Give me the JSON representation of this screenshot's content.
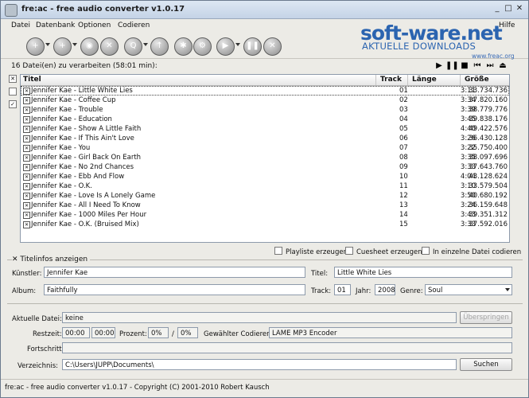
{
  "window": {
    "title": "fre:ac - free audio converter v1.0.17",
    "controls": {
      "minimize": "_",
      "maximize": "□",
      "close": "✕"
    }
  },
  "menu": [
    "Datei",
    "Datenbank",
    "Optionen",
    "Codieren"
  ],
  "help_menu": "Hilfe",
  "watermark": {
    "logo": "soft-ware.net",
    "subtitle": "AKTUELLE DOWNLOADS",
    "url": "www.freac.org"
  },
  "toolbar_icons": [
    "add-files-icon",
    "add-folder-icon",
    "cd-icon",
    "remove-icon",
    "search-cddb-icon",
    "submit-cddb-icon",
    "settings-icon",
    "config-icon",
    "start-encoding-icon",
    "pause-icon",
    "stop-icon"
  ],
  "file_count_label": "16 Datei(en) zu verarbeiten (58:01 min):",
  "player_controls": {
    "play": "▶",
    "pause": "❚❚",
    "stop": "■",
    "prev": "⏮",
    "next": "⏭",
    "eject": "⏏"
  },
  "list": {
    "columns": {
      "title": "Titel",
      "track": "Track",
      "length": "Länge",
      "size": "Größe"
    },
    "rows": [
      {
        "title": "Jennifer Kae - Little White Lies",
        "track": "01",
        "length": "3:11",
        "size": "33.734.736"
      },
      {
        "title": "Jennifer Kae - Coffee Cup",
        "track": "02",
        "length": "3:34",
        "size": "37.820.160"
      },
      {
        "title": "Jennifer Kae - Trouble",
        "track": "03",
        "length": "3:39",
        "size": "38.779.776"
      },
      {
        "title": "Jennifer Kae - Education",
        "track": "04",
        "length": "3:45",
        "size": "39.838.176"
      },
      {
        "title": "Jennifer Kae - Show A Little Faith",
        "track": "05",
        "length": "4:40",
        "size": "49.422.576"
      },
      {
        "title": "Jennifer Kae - If This Ain't Love",
        "track": "06",
        "length": "3:26",
        "size": "36.430.128"
      },
      {
        "title": "Jennifer Kae - You",
        "track": "07",
        "length": "3:22",
        "size": "35.750.400"
      },
      {
        "title": "Jennifer Kae - Girl Back On Earth",
        "track": "08",
        "length": "3:35",
        "size": "38.097.696"
      },
      {
        "title": "Jennifer Kae - No 2nd Chances",
        "track": "09",
        "length": "3:33",
        "size": "37.643.760"
      },
      {
        "title": "Jennifer Kae - Ebb And Flow",
        "track": "10",
        "length": "4:04",
        "size": "43.128.624"
      },
      {
        "title": "Jennifer Kae - O.K.",
        "track": "11",
        "length": "3:10",
        "size": "33.579.504"
      },
      {
        "title": "Jennifer Kae - Love Is A Lonely Game",
        "track": "12",
        "length": "3:50",
        "size": "40.680.192"
      },
      {
        "title": "Jennifer Kae - All I Need To Know",
        "track": "13",
        "length": "3:24",
        "size": "36.159.648"
      },
      {
        "title": "Jennifer Kae - 1000 Miles Per Hour",
        "track": "14",
        "length": "3:43",
        "size": "39.351.312"
      },
      {
        "title": "Jennifer Kae - O.K. (Bruised Mix)",
        "track": "15",
        "length": "3:33",
        "size": "37.592.016"
      }
    ]
  },
  "options": {
    "playlist": "Playliste erzeugen",
    "cuesheet": "Cuesheet erzeugen",
    "single_file": "In einzelne Datei codieren"
  },
  "titleinfo": {
    "toggle_label": "Titelinfos anzeigen",
    "artist_label": "Künstler:",
    "artist_value": "Jennifer Kae",
    "title_label": "Titel:",
    "title_value": "Little White Lies",
    "album_label": "Album:",
    "album_value": "Faithfully",
    "track_label": "Track:",
    "track_value": "01",
    "year_label": "Jahr:",
    "year_value": "2008",
    "genre_label": "Genre:",
    "genre_value": "Soul"
  },
  "progress": {
    "current_file_label": "Aktuelle Datei:",
    "current_file_value": "keine",
    "skip_button": "Überspringen",
    "remaining_label": "Restzeit:",
    "remaining_value": "00:00",
    "remaining_sep": "/",
    "total_value": "00:00",
    "percent_label": "Prozent:",
    "percent_value": "0%",
    "percent_sep": "/",
    "percent_total": "0%",
    "encoder_label": "Gewählter Codierer:",
    "encoder_value": "LAME MP3 Encoder",
    "progress_label": "Fortschritt:",
    "progress_fraction": 0,
    "dir_label": "Verzeichnis:",
    "dir_value": "C:\\Users\\JUPP\\Documents\\",
    "browse_button": "Suchen"
  },
  "status_text": "fre:ac - free audio converter v1.0.17 - Copyright (C) 2001-2010 Robert Kausch"
}
